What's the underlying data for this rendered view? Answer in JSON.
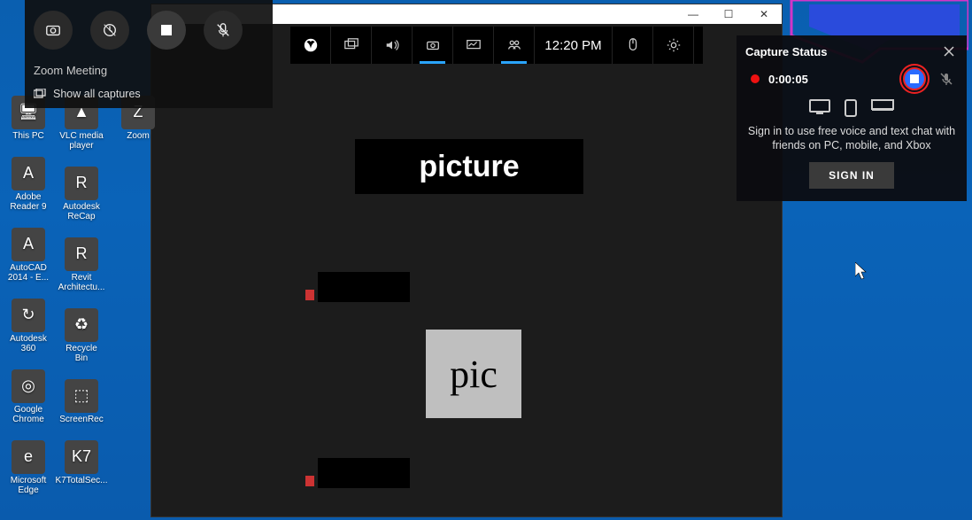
{
  "desktop": {
    "col1": [
      {
        "label": "This PC",
        "glyph": "🖥"
      },
      {
        "label": "Adobe Reader 9",
        "glyph": "A"
      },
      {
        "label": "AutoCAD 2014 - E...",
        "glyph": "A"
      },
      {
        "label": "Autodesk 360",
        "glyph": "↻"
      },
      {
        "label": "Google Chrome",
        "glyph": "◎"
      },
      {
        "label": "Microsoft Edge",
        "glyph": "e"
      }
    ],
    "col2": [
      {
        "label": "VLC media player",
        "glyph": "▲"
      },
      {
        "label": "Autodesk ReCap",
        "glyph": "R"
      },
      {
        "label": "Revit Architectu...",
        "glyph": "R"
      },
      {
        "label": "Recycle Bin",
        "glyph": "♻"
      },
      {
        "label": "ScreenRec",
        "glyph": "⬚"
      },
      {
        "label": "K7TotalSec...",
        "glyph": "K7"
      }
    ],
    "col3": [
      {
        "label": "Zoom",
        "glyph": "Z"
      }
    ]
  },
  "window": {
    "minimize": "—",
    "maximize": "☐",
    "close": "✕"
  },
  "gamebar": {
    "time": "12:20 PM"
  },
  "capture_widget": {
    "title": "Zoom Meeting",
    "show_all": "Show all captures"
  },
  "capture_status": {
    "title": "Capture Status",
    "time": "0:00:05",
    "signin_text": "Sign in to use free voice and text chat with friends on PC, mobile, and Xbox",
    "signin_btn": "SIGN IN"
  },
  "meeting": {
    "big_label": "picture",
    "pic_label": "pic"
  }
}
